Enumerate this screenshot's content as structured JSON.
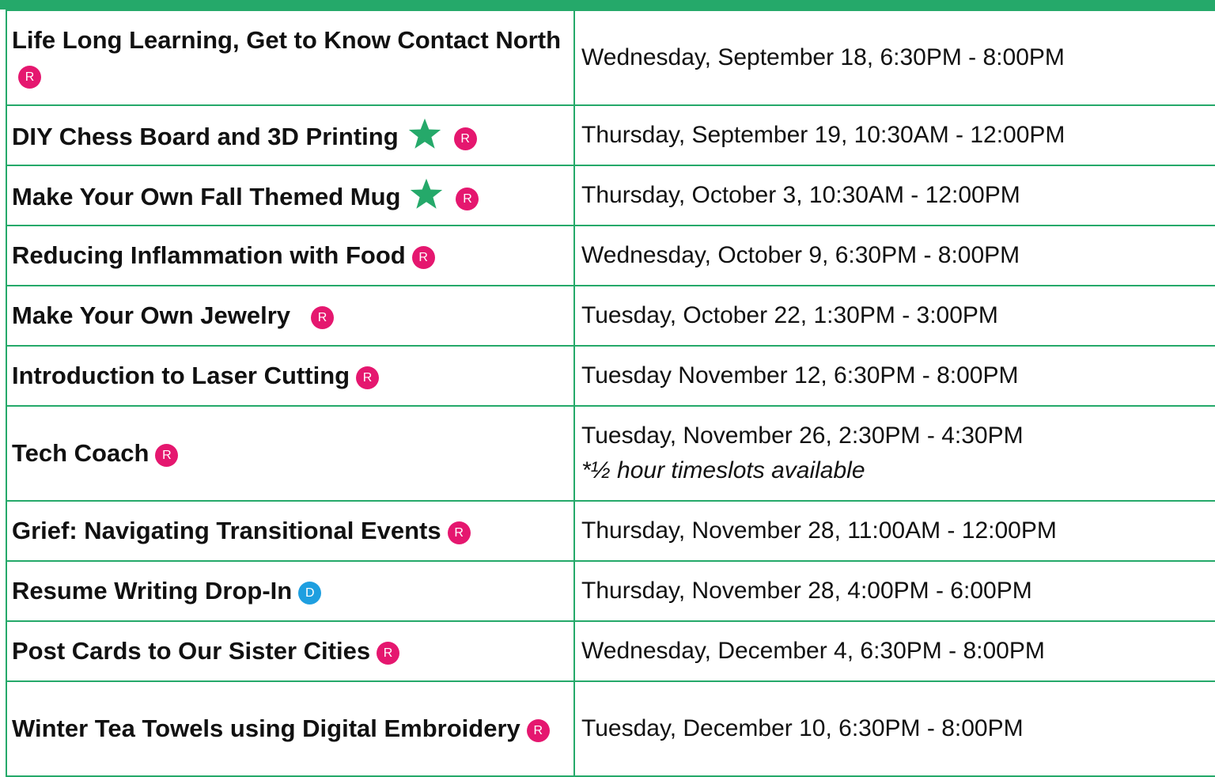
{
  "colors": {
    "border": "#25a96a",
    "badge_r": "#e5176f",
    "badge_d": "#1e9fe0",
    "star": "#25a96a"
  },
  "rows": [
    {
      "title": "Life Long Learning, Get to Know Contact North",
      "badge": "R",
      "star": false,
      "date": "Wednesday, September 18, 6:30PM - 8:00PM"
    },
    {
      "title": "DIY Chess Board and 3D Printing",
      "badge": "R",
      "star": true,
      "date": "Thursday, September 19, 10:30AM - 12:00PM"
    },
    {
      "title": "Make Your Own Fall Themed Mug",
      "badge": "R",
      "star": true,
      "date": "Thursday, October 3, 10:30AM - 12:00PM"
    },
    {
      "title": "Reducing Inflammation with Food",
      "badge": "R",
      "star": false,
      "date": "Wednesday, October 9, 6:30PM - 8:00PM"
    },
    {
      "title": "Make Your Own Jewelry",
      "badge": "R",
      "star": false,
      "date": "Tuesday, October 22, 1:30PM - 3:00PM"
    },
    {
      "title": "Introduction to Laser Cutting",
      "badge": "R",
      "star": false,
      "date": "Tuesday November 12, 6:30PM - 8:00PM"
    },
    {
      "title": "Tech Coach",
      "badge": "R",
      "star": false,
      "date": "Tuesday, November 26, 2:30PM - 4:30PM",
      "note": "*½ hour timeslots available"
    },
    {
      "title": "Grief: Navigating Transitional Events",
      "badge": "R",
      "star": false,
      "date": "Thursday, November 28, 11:00AM - 12:00PM"
    },
    {
      "title": "Resume Writing Drop-In",
      "badge": "D",
      "star": false,
      "date": "Thursday, November 28, 4:00PM - 6:00PM"
    },
    {
      "title": "Post Cards to Our Sister Cities",
      "badge": "R",
      "star": false,
      "date": "Wednesday, December 4, 6:30PM - 8:00PM"
    },
    {
      "title": "Winter Tea Towels using Digital Embroidery",
      "badge": "R",
      "star": false,
      "date": "Tuesday, December 10, 6:30PM - 8:00PM"
    }
  ]
}
